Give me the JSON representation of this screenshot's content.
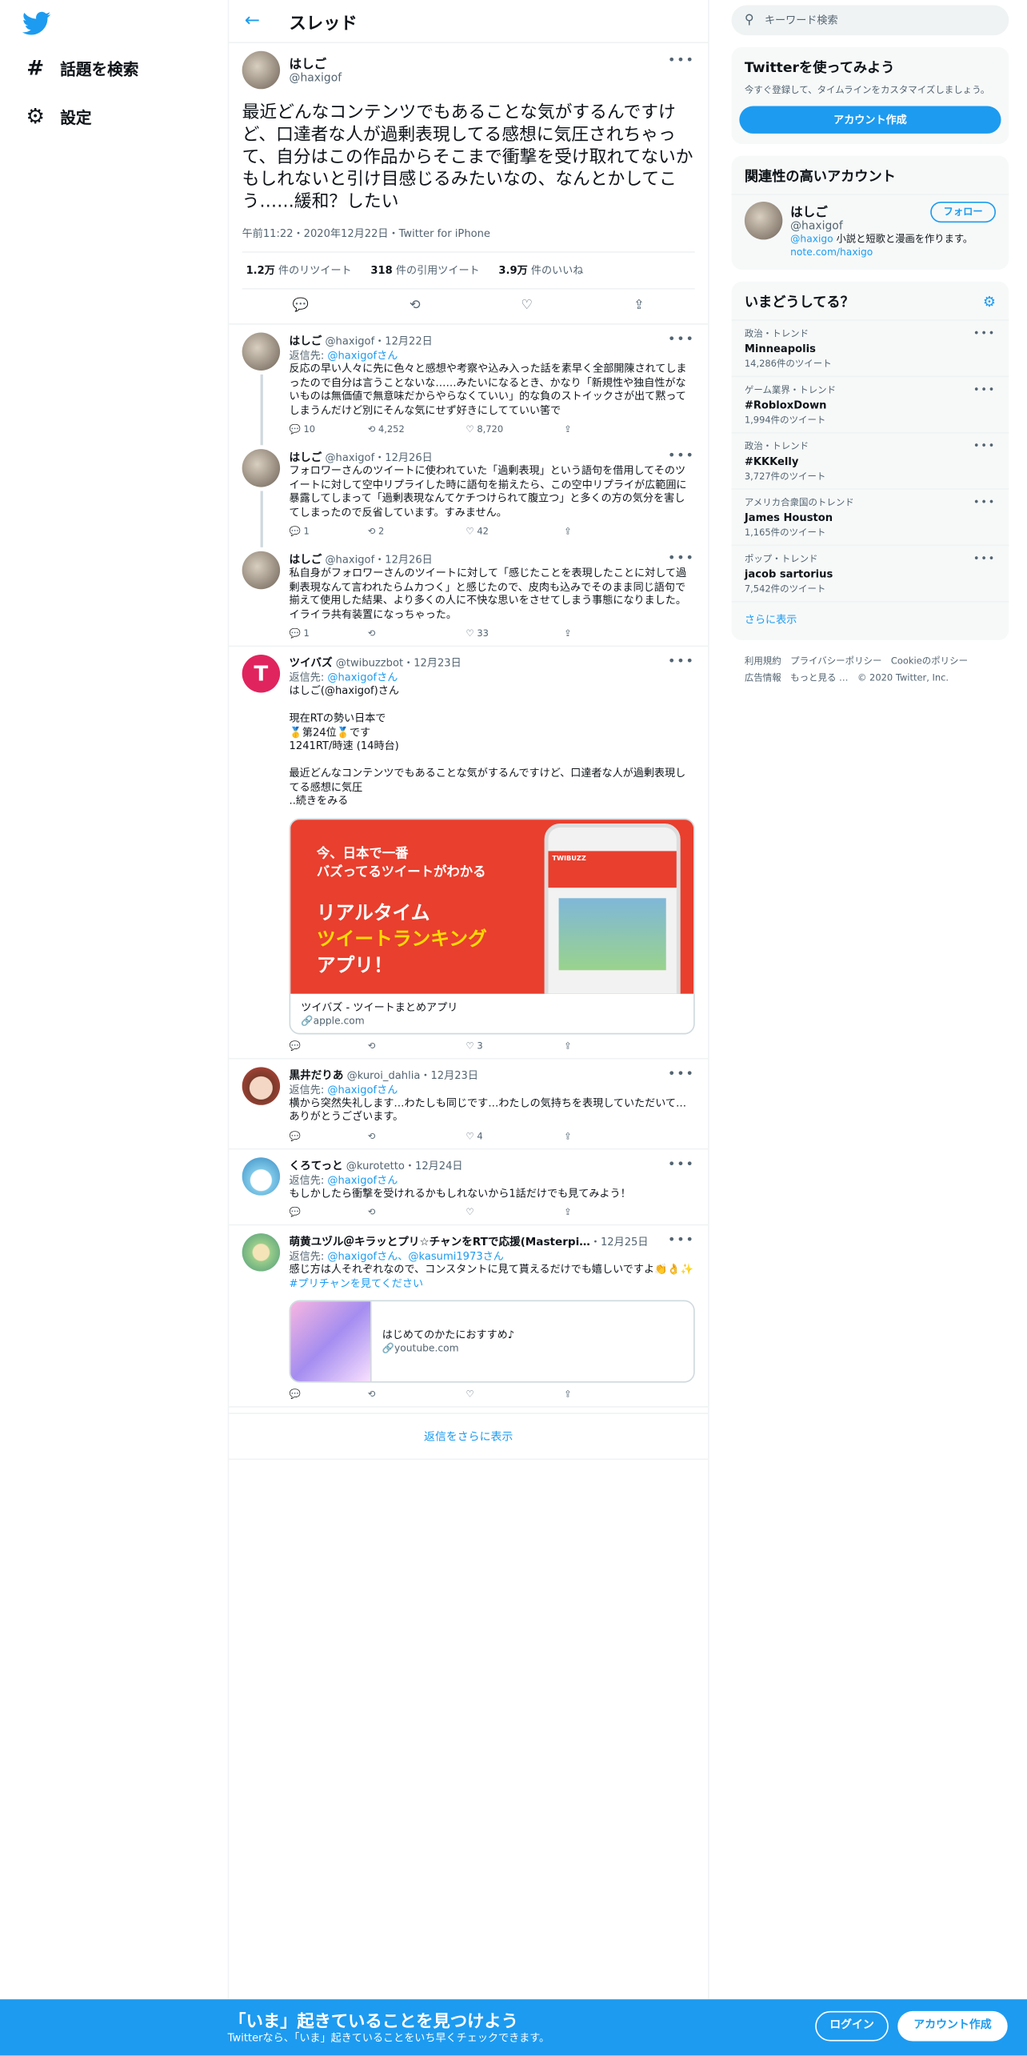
{
  "nav": {
    "explore": "話題を検索",
    "settings": "設定"
  },
  "header": {
    "title": "スレッド"
  },
  "focus_tweet": {
    "name": "はしご",
    "handle": "@haxigof",
    "text": "最近どんなコンテンツでもあることな気がするんですけど、口達者な人が過剰表現してる感想に気圧されちゃって、自分はこの作品からそこまで衝撃を受け取れてないかもしれないと引け目感じるみたいなの、なんとかしてこう……緩和？したい",
    "meta": "午前11:22・2020年12月22日・Twitter for iPhone",
    "retweets": "1.2万",
    "retweets_label": "件のリツイート",
    "quotes": "318",
    "quotes_label": "件の引用ツイート",
    "likes": "3.9万",
    "likes_label": "件のいいね"
  },
  "replies": [
    {
      "name": "はしご",
      "handle": "@haxigof",
      "date": "・12月22日",
      "reply_prefix": "返信先: ",
      "reply_to": "@haxigofさん",
      "text": "反応の早い人々に先に色々と感想や考察や込み入った話を素早く全部開陳されてしまったので自分は言うことないな……みたいになるとき、かなり「新規性や独自性がないものは無価値で無意味だからやらなくていい」的な負のストイックさが出て黙ってしまうんだけど別にそんな気にせず好きにしてていい筈で",
      "replies": "10",
      "retweets": "4,252",
      "likes": "8,720"
    },
    {
      "name": "はしご",
      "handle": "@haxigof",
      "date": "・12月26日",
      "text": "フォロワーさんのツイートに使われていた「過剰表現」という語句を借用してそのツイートに対して空中リプライした時に語句を揃えたら、この空中リプライが広範囲に暴露してしまって「過剰表現なんてケチつけられて腹立つ」と多くの方の気分を害してしまったので反省しています。すみません。",
      "replies": "1",
      "retweets": "2",
      "likes": "42"
    },
    {
      "name": "はしご",
      "handle": "@haxigof",
      "date": "・12月26日",
      "text": "私自身がフォロワーさんのツイートに対して「感じたことを表現したことに対して過剰表現なんて言われたらムカつく」と感じたので、皮肉も込みでそのまま同じ語句で揃えて使用した結果、より多くの人に不快な思いをさせてしまう事態になりました。イライラ共有装置になっちゃった。",
      "replies": "1",
      "retweets": "",
      "likes": "33"
    },
    {
      "name": "ツイバズ",
      "handle": "@twibuzzbot",
      "date": "・12月23日",
      "reply_prefix": "返信先: ",
      "reply_to": "@haxigofさん",
      "text": "はしご(@haxigof)さん\n\n現在RTの勢い日本で\n🥇第24位🥇です\n1241RT/時速 (14時台)\n\n最近どんなコンテンツでもあることな気がするんですけど、口達者な人が過剰表現してる感想に気圧\n..続きをみる",
      "card_title": "ツイバズ - ツイートまとめアプリ",
      "card_domain": "apple.com",
      "card_l1": "今、日本で一番\nバズってるツイートがわかる",
      "card_l2a": "リアルタイム",
      "card_l2b": "ツイートランキング",
      "card_l2c": "アプリ！",
      "card_phone": "TWIBUZZ",
      "replies": "",
      "retweets": "",
      "likes": "3"
    },
    {
      "name": "黒井だりあ",
      "handle": "@kuroi_dahlia",
      "date": "・12月23日",
      "reply_prefix": "返信先: ",
      "reply_to": "@haxigofさん",
      "text": "横から突然失礼します…わたしも同じです…わたしの気持ちを表現していただいて…ありがとうございます。",
      "replies": "",
      "retweets": "",
      "likes": "4"
    },
    {
      "name": "くろてっと",
      "handle": "@kurotetto",
      "date": "・12月24日",
      "reply_prefix": "返信先: ",
      "reply_to": "@haxigofさん",
      "text": "もしかしたら衝撃を受けれるかもしれないから1話だけでも見てみよう！",
      "replies": "",
      "retweets": "",
      "likes": ""
    },
    {
      "name": "萌黄ユヅル＠キラッとプリ☆チャンをRTで応援(Masterpi…",
      "handle": "",
      "date": "・12月25日",
      "reply_prefix": "返信先: ",
      "reply_to": "@haxigofさん、@kasumi1973さん",
      "text": "感じ方は人それぞれなので、コンスタントに見て貰えるだけでも嬉しいですよ👏👌✨",
      "hashtag": "#プリチャンを見てください",
      "card_title": "はじめてのかたにおすすめ♪",
      "card_domain": "youtube.com",
      "replies": "",
      "retweets": "",
      "likes": ""
    }
  ],
  "show_more_replies": "返信をさらに表示",
  "search": {
    "placeholder": "キーワード検索"
  },
  "join": {
    "title": "Twitterを使ってみよう",
    "sub": "今すぐ登録して、タイムラインをカスタマイズしましょう。",
    "button": "アカウント作成"
  },
  "relevant": {
    "title": "関連性の高いアカウント",
    "name": "はしご",
    "handle": "@haxigof",
    "follow": "フォロー",
    "desc_handle": "@haxigo",
    "desc": " 小説と短歌と漫画を作ります。",
    "link": "note.com/haxigo"
  },
  "trends": {
    "title": "いまどうしてる？",
    "items": [
      {
        "cat": "政治・トレンド",
        "name": "Minneapolis",
        "count": "14,286件のツイート"
      },
      {
        "cat": "ゲーム業界・トレンド",
        "name": "#RobloxDown",
        "count": "1,994件のツイート"
      },
      {
        "cat": "政治・トレンド",
        "name": "#KKKelly",
        "count": "3,727件のツイート"
      },
      {
        "cat": "アメリカ合衆国のトレンド",
        "name": "James Houston",
        "count": "1,165件のツイート"
      },
      {
        "cat": "ポップ・トレンド",
        "name": "jacob sartorius",
        "count": "7,542件のツイート"
      }
    ],
    "more": "さらに表示"
  },
  "footer": {
    "terms": "利用規約",
    "privacy": "プライバシーポリシー",
    "cookie": "Cookieのポリシー",
    "ads": "広告情報",
    "more": "もっと見る …",
    "copy": "© 2020 Twitter, Inc."
  },
  "bottom": {
    "title": "「いま」起きていることを見つけよう",
    "sub": "Twitterなら、「いま」起きていることをいち早くチェックできます。",
    "login": "ログイン",
    "signup": "アカウント作成"
  },
  "colors": {
    "accent": "#1d9bf0",
    "text": "#0f1419",
    "muted": "#536471"
  }
}
